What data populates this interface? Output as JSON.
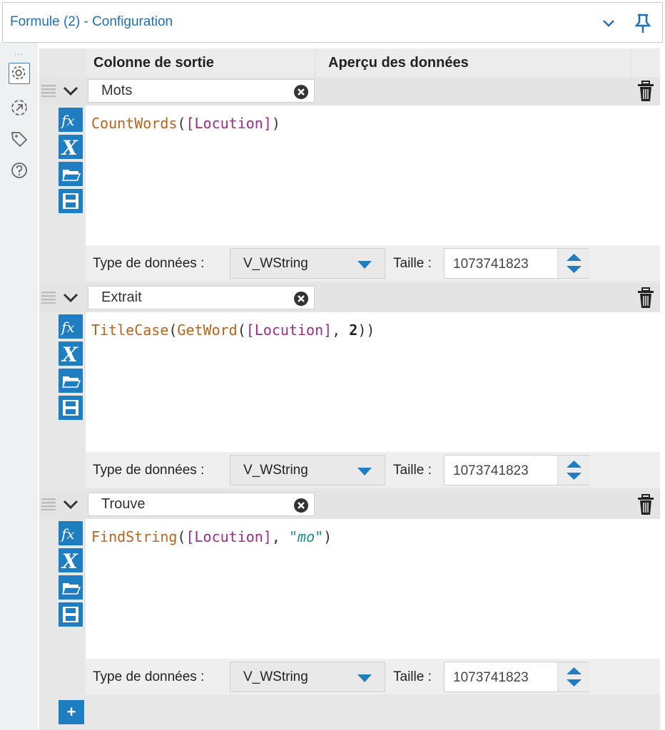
{
  "window": {
    "title": "Formule (2) - Configuration",
    "icons": {
      "collapse": "chevron-down-icon",
      "pin": "pin-icon"
    }
  },
  "rail": {
    "dots": "...",
    "icons": [
      "gear-icon",
      "connection-icon",
      "tag-icon",
      "help-icon"
    ]
  },
  "table": {
    "col_output": "Colonne de sortie",
    "col_preview": "Aperçu des données"
  },
  "labels": {
    "data_type": "Type de données :",
    "size": "Taille :"
  },
  "formulas": [
    {
      "name": "Mots",
      "expr_parts": [
        "CountWords",
        "(",
        "[Locution]",
        ")"
      ],
      "data_type": "V_WString",
      "size": "1073741823"
    },
    {
      "name": "Extrait",
      "expr_parts": [
        "TitleCase",
        "(",
        "GetWord",
        "(",
        "[Locution]",
        ", ",
        "2",
        "))"
      ],
      "data_type": "V_WString",
      "size": "1073741823"
    },
    {
      "name": "Trouve",
      "expr_parts": [
        "FindString",
        "(",
        "[Locution]",
        ", ",
        "\"mo\"",
        ")"
      ],
      "data_type": "V_WString",
      "size": "1073741823"
    }
  ],
  "add_button": "+",
  "colors": {
    "accent": "#1f7ec2",
    "title": "#1f6fb5",
    "function": "#b5651d",
    "field": "#9b2d8a",
    "string": "#1c8a8a"
  }
}
